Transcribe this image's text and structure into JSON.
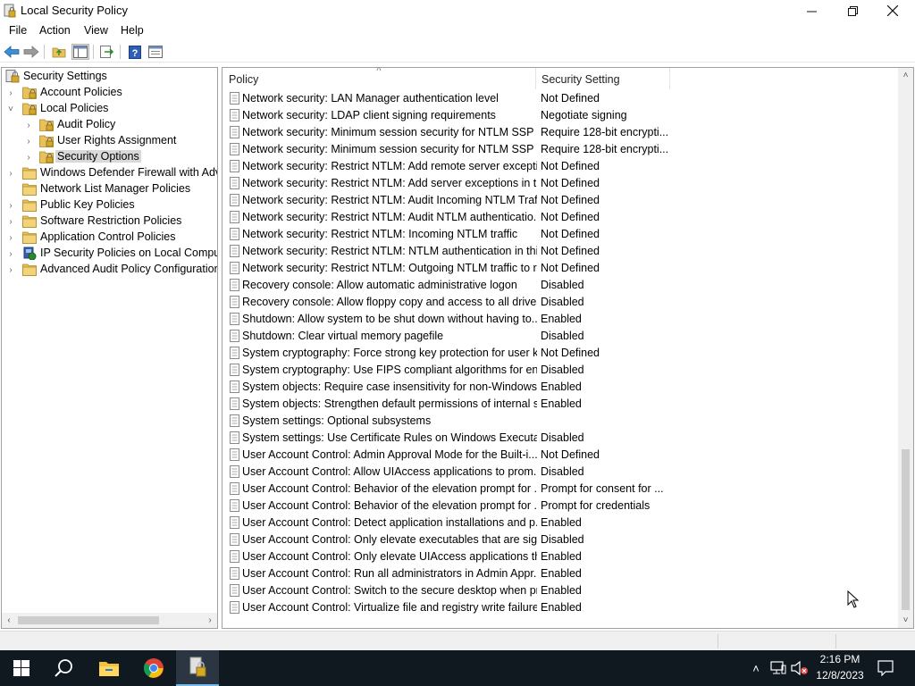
{
  "window": {
    "title": "Local Security Policy",
    "minimize_label": "—",
    "restore_label": "❐",
    "close_label": "✕"
  },
  "menu": [
    "File",
    "Action",
    "View",
    "Help"
  ],
  "toolbar": {
    "icons": [
      "back-arrow-icon",
      "forward-arrow-icon",
      "up-folder-icon",
      "show-hide-tree-icon",
      "export-list-icon",
      "help-icon",
      "properties-icon"
    ]
  },
  "tree": {
    "nodes": [
      {
        "label": "Security Settings",
        "level": 0,
        "expander": "",
        "icon": "security-settings-icon"
      },
      {
        "label": "Account Policies",
        "level": 1,
        "expander": "›",
        "icon": "lock-folder-icon"
      },
      {
        "label": "Local Policies",
        "level": 1,
        "expander": "˅",
        "icon": "lock-folder-icon"
      },
      {
        "label": "Audit Policy",
        "level": 2,
        "expander": "›",
        "icon": "lock-folder-icon"
      },
      {
        "label": "User Rights Assignment",
        "level": 2,
        "expander": "›",
        "icon": "lock-folder-icon"
      },
      {
        "label": "Security Options",
        "level": 2,
        "expander": "›",
        "icon": "lock-folder-icon",
        "selected": true
      },
      {
        "label": "Windows Defender Firewall with Adva",
        "level": 1,
        "expander": "›",
        "icon": "folder-icon"
      },
      {
        "label": "Network List Manager Policies",
        "level": 1,
        "expander": "",
        "icon": "folder-icon"
      },
      {
        "label": "Public Key Policies",
        "level": 1,
        "expander": "›",
        "icon": "folder-icon"
      },
      {
        "label": "Software Restriction Policies",
        "level": 1,
        "expander": "›",
        "icon": "folder-icon"
      },
      {
        "label": "Application Control Policies",
        "level": 1,
        "expander": "›",
        "icon": "folder-icon"
      },
      {
        "label": "IP Security Policies on Local Compute",
        "level": 1,
        "expander": "›",
        "icon": "ipsec-icon"
      },
      {
        "label": "Advanced Audit Policy Configuration",
        "level": 1,
        "expander": "›",
        "icon": "folder-icon"
      }
    ],
    "scroll_left": "‹",
    "scroll_right": "›"
  },
  "list": {
    "columns": [
      "Policy",
      "Security Setting"
    ],
    "sort_indicator": "˄",
    "rows": [
      {
        "policy": "Network security: LAN Manager authentication level",
        "setting": "Not Defined"
      },
      {
        "policy": "Network security: LDAP client signing requirements",
        "setting": "Negotiate signing"
      },
      {
        "policy": "Network security: Minimum session security for NTLM SSP ...",
        "setting": "Require 128-bit encrypti..."
      },
      {
        "policy": "Network security: Minimum session security for NTLM SSP ...",
        "setting": "Require 128-bit encrypti..."
      },
      {
        "policy": "Network security: Restrict NTLM: Add remote server excepti...",
        "setting": "Not Defined"
      },
      {
        "policy": "Network security: Restrict NTLM: Add server exceptions in t...",
        "setting": "Not Defined"
      },
      {
        "policy": "Network security: Restrict NTLM: Audit Incoming NTLM Traf...",
        "setting": "Not Defined"
      },
      {
        "policy": "Network security: Restrict NTLM: Audit NTLM authenticatio...",
        "setting": "Not Defined"
      },
      {
        "policy": "Network security: Restrict NTLM: Incoming NTLM traffic",
        "setting": "Not Defined"
      },
      {
        "policy": "Network security: Restrict NTLM: NTLM authentication in thi...",
        "setting": "Not Defined"
      },
      {
        "policy": "Network security: Restrict NTLM: Outgoing NTLM traffic to r...",
        "setting": "Not Defined"
      },
      {
        "policy": "Recovery console: Allow automatic administrative logon",
        "setting": "Disabled"
      },
      {
        "policy": "Recovery console: Allow floppy copy and access to all drives...",
        "setting": "Disabled"
      },
      {
        "policy": "Shutdown: Allow system to be shut down without having to...",
        "setting": "Enabled"
      },
      {
        "policy": "Shutdown: Clear virtual memory pagefile",
        "setting": "Disabled"
      },
      {
        "policy": "System cryptography: Force strong key protection for user k...",
        "setting": "Not Defined"
      },
      {
        "policy": "System cryptography: Use FIPS compliant algorithms for en...",
        "setting": "Disabled"
      },
      {
        "policy": "System objects: Require case insensitivity for non-Windows ...",
        "setting": "Enabled"
      },
      {
        "policy": "System objects: Strengthen default permissions of internal s...",
        "setting": "Enabled"
      },
      {
        "policy": "System settings: Optional subsystems",
        "setting": ""
      },
      {
        "policy": "System settings: Use Certificate Rules on Windows Executab...",
        "setting": "Disabled"
      },
      {
        "policy": "User Account Control: Admin Approval Mode for the Built-i...",
        "setting": "Not Defined"
      },
      {
        "policy": "User Account Control: Allow UIAccess applications to prom...",
        "setting": "Disabled"
      },
      {
        "policy": "User Account Control: Behavior of the elevation prompt for ...",
        "setting": "Prompt for consent for ..."
      },
      {
        "policy": "User Account Control: Behavior of the elevation prompt for ...",
        "setting": "Prompt for credentials"
      },
      {
        "policy": "User Account Control: Detect application installations and p...",
        "setting": "Enabled"
      },
      {
        "policy": "User Account Control: Only elevate executables that are sig...",
        "setting": "Disabled"
      },
      {
        "policy": "User Account Control: Only elevate UIAccess applications th...",
        "setting": "Enabled"
      },
      {
        "policy": "User Account Control: Run all administrators in Admin Appr...",
        "setting": "Enabled"
      },
      {
        "policy": "User Account Control: Switch to the secure desktop when pr...",
        "setting": "Enabled"
      },
      {
        "policy": "User Account Control: Virtualize file and registry write failure...",
        "setting": "Enabled"
      }
    ],
    "scroll_up": "˄",
    "scroll_down": "˅"
  },
  "taskbar": {
    "items": [
      "start-icon",
      "search-icon",
      "file-explorer-icon",
      "chrome-icon",
      "local-security-policy-icon"
    ],
    "time": "2:16 PM",
    "date": "12/8/2023",
    "tray_chevron": "˄"
  },
  "colors": {
    "taskbar": "#101820",
    "selection": "#d9d9d9",
    "folder": "#e8c15a",
    "back_arrow": "#3b8fd6"
  }
}
